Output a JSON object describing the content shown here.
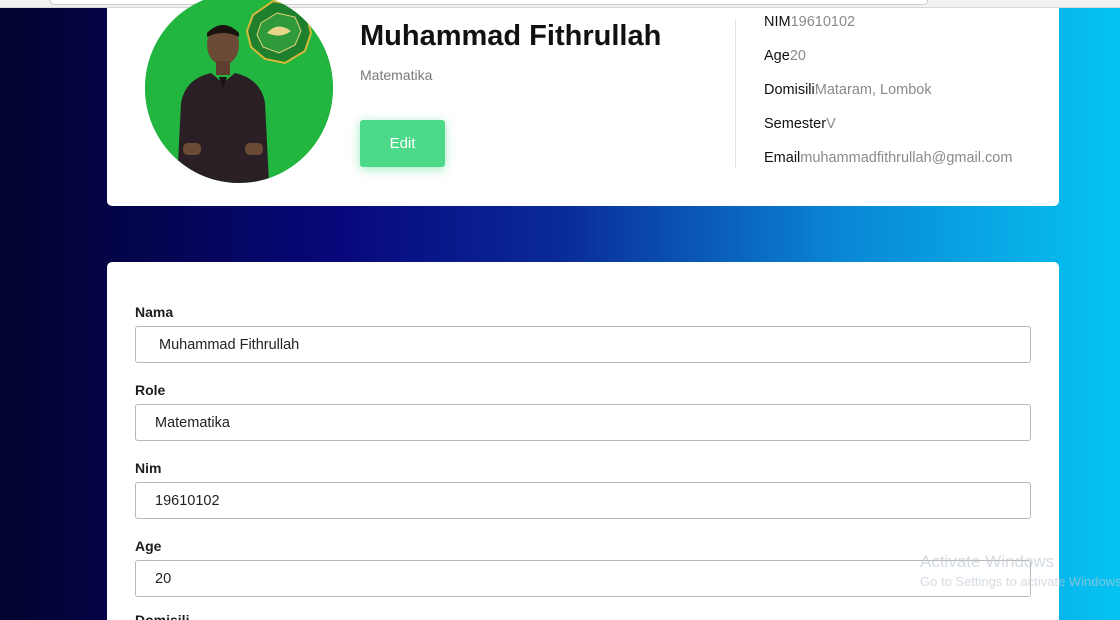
{
  "profile": {
    "name": "Muhammad Fithrullah",
    "role": "Matematika",
    "edit_label": "Edit",
    "info": [
      {
        "key": "NIM",
        "value": "19610102"
      },
      {
        "key": "Age",
        "value": "20"
      },
      {
        "key": "Domisili",
        "value": "Mataram, Lombok"
      },
      {
        "key": "Semester",
        "value": "V"
      },
      {
        "key": "Email",
        "value": "muhammadfithrullah@gmail.com"
      }
    ]
  },
  "form": {
    "fields": [
      {
        "label": "Nama",
        "value": "Muhammad Fithrullah"
      },
      {
        "label": "Role",
        "value": "Matematika"
      },
      {
        "label": "Nim",
        "value": "19610102"
      },
      {
        "label": "Age",
        "value": "20"
      },
      {
        "label": "Domisili",
        "value": ""
      }
    ]
  },
  "watermark": {
    "line1": "Activate Windows",
    "line2": "Go to Settings to activate Windows."
  },
  "colors": {
    "edit_button": "#4cd98a",
    "avatar_bg": "#22b53f",
    "gradient_start": "#03032e",
    "gradient_end": "#05c4f2"
  },
  "icons": {
    "avatar": "profile-photo",
    "logo": "university-emblem"
  }
}
